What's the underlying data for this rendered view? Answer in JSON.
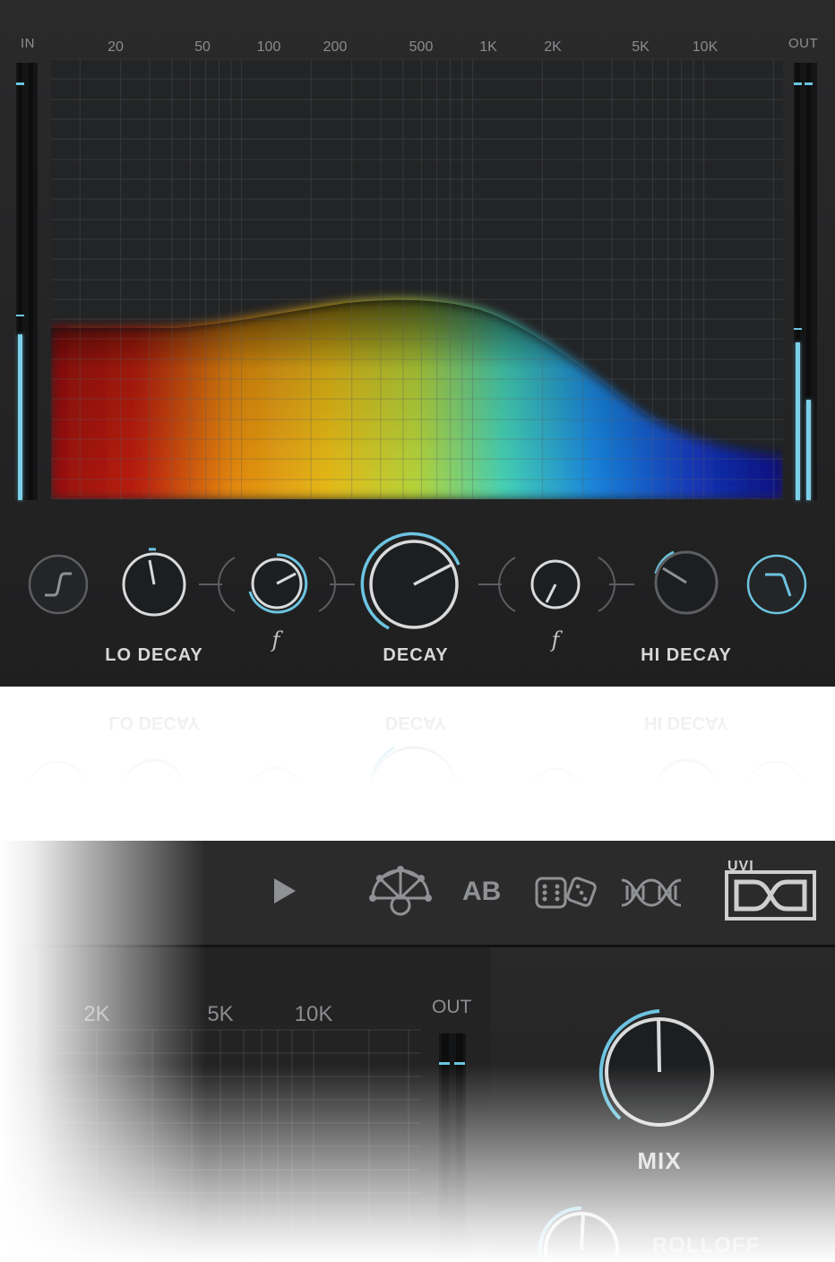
{
  "top": {
    "in_label": "IN",
    "out_label": "OUT",
    "freq_labels": [
      "20",
      "50",
      "100",
      "200",
      "500",
      "1K",
      "2K",
      "5K",
      "10K"
    ],
    "in_meter_level": 0.38,
    "out_meter_levels": [
      0.36,
      0.23
    ],
    "controls": {
      "lo_decay_label": "LO DECAY",
      "decay_label": "DECAY",
      "hi_decay_label": "HI DECAY",
      "f_left": "f",
      "f_right": "f"
    },
    "accent_color": "#6cc4e0",
    "spectrum_colors": [
      "#b01010",
      "#f08a10",
      "#c6e03a",
      "#3fd8c8",
      "#1a70e8",
      "#121a9a"
    ]
  },
  "bottom": {
    "ab_label": "AB",
    "logo_text": "UVI",
    "freq_labels": [
      "2K",
      "5K",
      "10K"
    ],
    "out_label": "OUT",
    "mix_label": "MIX",
    "rolloff_label": "ROLLOFF",
    "icons": [
      "play-icon",
      "network-icon",
      "ab-compare",
      "dice-icon",
      "dna-icon",
      "uvi-logo"
    ]
  }
}
